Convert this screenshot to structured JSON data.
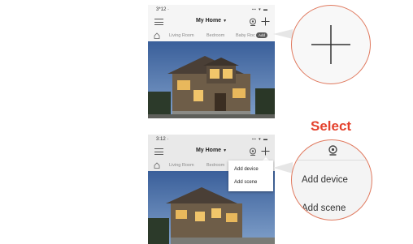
{
  "top_phone": {
    "status_time": "3*12 ·",
    "status_icons": "▪▪ ▾ ▬",
    "title": "My Home",
    "tabs": [
      "Living Room",
      "Bedroom",
      "Baby Roc"
    ],
    "add_badge": "Add"
  },
  "bottom_phone": {
    "status_time": "3:12 ·",
    "status_icons": "▪▪ ▾ ▬",
    "title": "My Home",
    "tabs": [
      "Living Room",
      "Bedroom"
    ],
    "menu": {
      "add_device": "Add device",
      "add_scene": "Add scene"
    }
  },
  "callout": {
    "select_label": "Select",
    "add_device": "Add device",
    "add_scene": "Add scene"
  },
  "colors": {
    "accent": "#e4422d",
    "circle_border": "#e07a5f",
    "sky": "#3a5f9a"
  },
  "icons": {
    "menu": "hamburger-menu-icon",
    "camera": "camera-icon",
    "add": "plus-icon",
    "home": "home-icon"
  }
}
